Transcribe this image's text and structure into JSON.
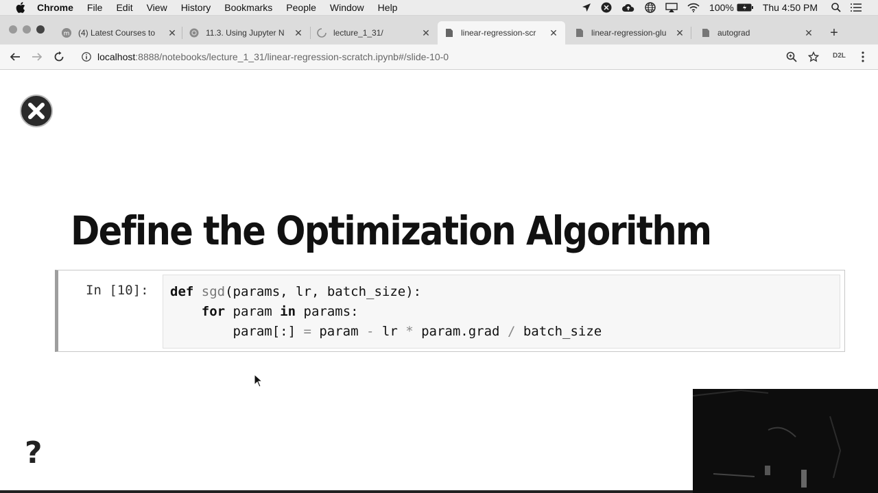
{
  "menubar": {
    "app_name": "Chrome",
    "items": [
      "File",
      "Edit",
      "View",
      "History",
      "Bookmarks",
      "People",
      "Window",
      "Help"
    ],
    "battery": "100%",
    "clock": "Thu 4:50 PM"
  },
  "tabs": [
    {
      "title": "(4) Latest Courses to",
      "favicon": "m-icon"
    },
    {
      "title": "11.3. Using Jupyter N",
      "favicon": "globe-icon"
    },
    {
      "title": "lecture_1_31/",
      "favicon": "loading-icon"
    },
    {
      "title": "linear-regression-scr",
      "favicon": "document-icon",
      "active": true
    },
    {
      "title": "linear-regression-glu",
      "favicon": "document-icon"
    },
    {
      "title": "autograd",
      "favicon": "document-icon"
    }
  ],
  "address_bar": {
    "host": "localhost",
    "path": ":8888/notebooks/lecture_1_31/linear-regression-scratch.ipynb#/slide-10-0"
  },
  "extension_label": "D2L",
  "slide": {
    "title": "Define the Optimization Algorithm",
    "cell_prompt": "In [10]:",
    "code": {
      "l1_kw": "def",
      "l1_fn": "sgd",
      "l1_rest": "(params, lr, batch_size):",
      "l2_indent": "    ",
      "l2_kw1": "for",
      "l2_mid": " param ",
      "l2_kw2": "in",
      "l2_rest": " params:",
      "l3_indent": "        ",
      "l3_a": "param[:] ",
      "l3_eq": "=",
      "l3_b": " param ",
      "l3_minus": "-",
      "l3_c": " lr ",
      "l3_mul": "*",
      "l3_d": " param.grad ",
      "l3_div": "/",
      "l3_e": " batch_size"
    },
    "help_label": "?"
  }
}
